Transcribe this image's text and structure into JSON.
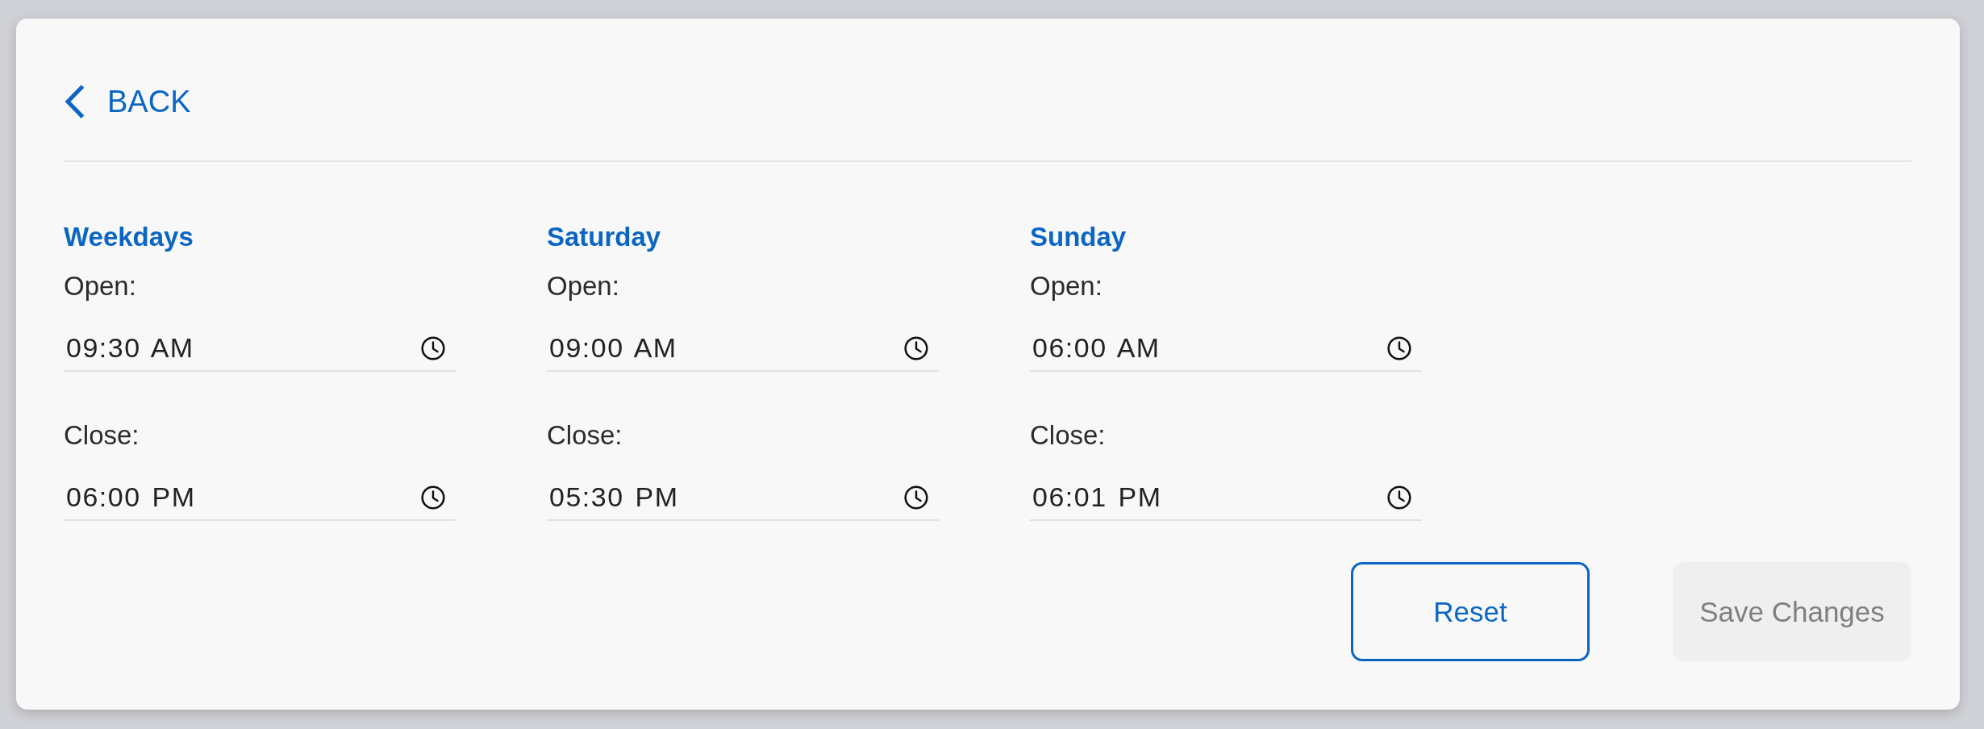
{
  "back_link": {
    "label": "BACK"
  },
  "schedule": [
    {
      "heading": "Weekdays",
      "fields": [
        {
          "label": "Open:",
          "value": "09:30 AM"
        },
        {
          "label": "Close:",
          "value": "06:00 PM"
        }
      ]
    },
    {
      "heading": "Saturday",
      "fields": [
        {
          "label": "Open:",
          "value": "09:00 AM"
        },
        {
          "label": "Close:",
          "value": "05:30 PM"
        }
      ]
    },
    {
      "heading": "Sunday",
      "fields": [
        {
          "label": "Open:",
          "value": "06:00 AM"
        },
        {
          "label": "Close:",
          "value": "06:01 PM"
        }
      ]
    }
  ],
  "buttons": [
    {
      "label": "Reset",
      "kind": "outline",
      "disabled": false
    },
    {
      "label": "Save Changes",
      "kind": "filled",
      "disabled": true
    }
  ]
}
